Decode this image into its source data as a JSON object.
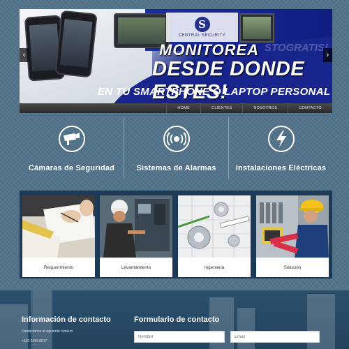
{
  "slider": {
    "logo_letter": "S",
    "logo_text": "CENTRAL SECURITY",
    "ghost_text": "STOGRATIS!",
    "headline1": "MONITOREA",
    "headline2": "DESDE DONDE ESTES!",
    "headline3": "EN TU SMARTPHONE O LAPTOP PERSONAL",
    "prev_arrow": "‹",
    "next_arrow": "›"
  },
  "nav": {
    "items": [
      "HOME",
      "CLIENTES",
      "NOSOTROS",
      "CONTACTO"
    ]
  },
  "services": [
    {
      "title": "Cámaras de Seguridad",
      "icon": "camera-icon"
    },
    {
      "title": "Sistemas de Alarmas",
      "icon": "alarm-icon"
    },
    {
      "title": "Instalaciones Eléctricas",
      "icon": "lightning-icon"
    }
  ],
  "cards": [
    {
      "label": "Requerimiento"
    },
    {
      "label": "Levantamiento"
    },
    {
      "label": "Ingenieria"
    },
    {
      "label": "Solución"
    }
  ],
  "footer": {
    "contact_info_title": "Información de contacto",
    "contact_subtitle": "Contáctanos al siguiente número",
    "phone": "+503 2456 8817",
    "form_title": "Formulario de contacto",
    "name_placeholder": "Nombre",
    "email_placeholder": "Email"
  },
  "colors": {
    "background": "#4f6f86",
    "nav_bar": "#2a2a2a",
    "cards_panel": "#1c3a55",
    "brand_blue": "#18258c"
  }
}
